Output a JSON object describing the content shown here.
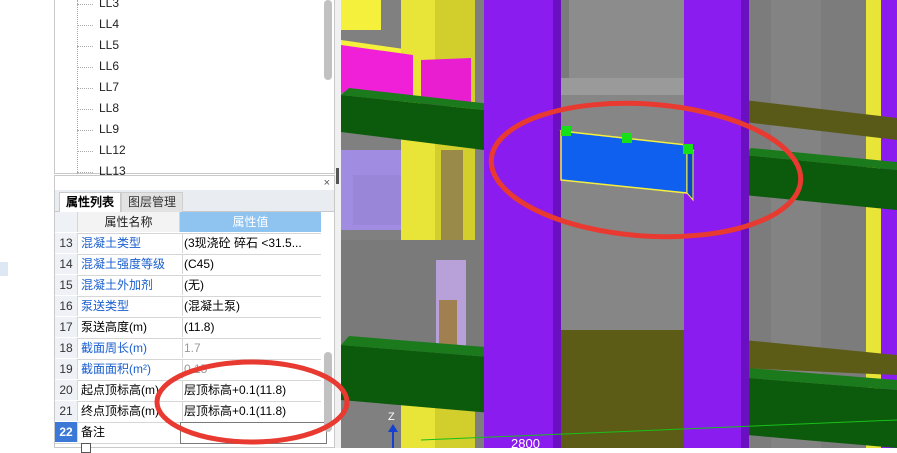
{
  "tree": {
    "items": [
      "LL3",
      "LL4",
      "LL5",
      "LL6",
      "LL7",
      "LL8",
      "LL9",
      "LL12",
      "LL13"
    ]
  },
  "panel": {
    "close_glyph": "×",
    "tabs": [
      "属性列表",
      "图层管理"
    ],
    "headers": {
      "name": "属性名称",
      "value": "属性值"
    },
    "rows": [
      {
        "num": "13",
        "name": "混凝土类型",
        "value": "(3现浇砼 碎石 <31.5...",
        "name_style": "blue"
      },
      {
        "num": "14",
        "name": "混凝土强度等级",
        "value": "(C45)",
        "name_style": "blue"
      },
      {
        "num": "15",
        "name": "混凝土外加剂",
        "value": "(无)",
        "name_style": "blue"
      },
      {
        "num": "16",
        "name": "泵送类型",
        "value": "(混凝土泵)",
        "name_style": "blue"
      },
      {
        "num": "17",
        "name": "泵送高度(m)",
        "value": "(11.8)",
        "name_style": "black"
      },
      {
        "num": "18",
        "name": "截面周长(m)",
        "value": "1.7",
        "name_style": "blue",
        "value_style": "gray"
      },
      {
        "num": "19",
        "name": "截面面积(m²)",
        "value": "0.15",
        "name_style": "blue",
        "value_style": "gray"
      },
      {
        "num": "20",
        "name": "起点顶标高(m)",
        "value": "层顶标高+0.1(11.8)",
        "name_style": "black"
      },
      {
        "num": "21",
        "name": "终点顶标高(m)",
        "value": "层顶标高+0.1(11.8)",
        "name_style": "black"
      },
      {
        "num": "22",
        "name": "备注",
        "value": "",
        "name_style": "black",
        "selected": true
      }
    ]
  },
  "viewport": {
    "axis_label": "Z",
    "dimension_text": "2800",
    "colors": {
      "column_purple": "#8b1cf0",
      "beam_green": "#0c5a0c",
      "wall_gray": "#8a8a8a",
      "slab_olive": "#5c5c16",
      "yellow": "#f5f03c",
      "magenta": "#f020d8",
      "selected_beam": "#1060f0",
      "annotation_red": "#e83a30",
      "grip_green": "#18e018"
    }
  }
}
